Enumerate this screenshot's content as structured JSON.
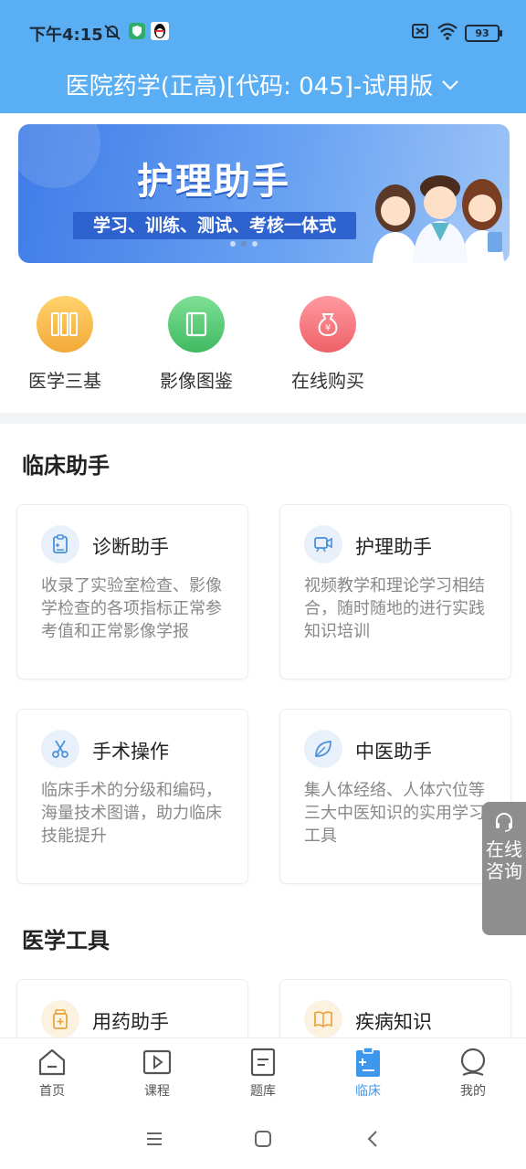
{
  "status": {
    "time": "下午4:15",
    "battery": "93"
  },
  "header": {
    "title": "医院药学(正高)[代码: 045]-试用版"
  },
  "banner": {
    "title": "护理助手",
    "slogan": "学习、训练、测试、考核一体式"
  },
  "quick": [
    {
      "label": "医学三基",
      "color": "#f7b84a",
      "icon": "books-icon"
    },
    {
      "label": "影像图鉴",
      "color": "#5fce7a",
      "icon": "album-icon"
    },
    {
      "label": "在线购买",
      "color": "#f37c82",
      "icon": "money-bag-icon"
    }
  ],
  "clinical": {
    "title": "临床助手",
    "cards": [
      {
        "title": "诊断助手",
        "desc": "收录了实验室检查、影像学检查的各项指标正常参考值和正常影像学报",
        "icon": "clipboard-icon"
      },
      {
        "title": "护理助手",
        "desc": "视频教学和理论学习相结合，随时随地的进行实践知识培训",
        "icon": "video-icon"
      },
      {
        "title": "手术操作",
        "desc": "临床手术的分级和编码，海量技术图谱，助力临床技能提升",
        "icon": "scissors-icon"
      },
      {
        "title": "中医助手",
        "desc": "集人体经络、人体穴位等三大中医知识的实用学习工具",
        "icon": "leaf-icon"
      }
    ]
  },
  "tools": {
    "title": "医学工具",
    "cards": [
      {
        "title": "用药助手",
        "icon": "medicine-bottle-icon"
      },
      {
        "title": "疾病知识",
        "icon": "book-icon"
      }
    ]
  },
  "consult": {
    "label": "在线咨询"
  },
  "tabs": [
    {
      "label": "首页",
      "icon": "home-icon"
    },
    {
      "label": "课程",
      "icon": "play-icon"
    },
    {
      "label": "题库",
      "icon": "document-icon"
    },
    {
      "label": "临床",
      "icon": "clinical-clipboard-icon",
      "active": true
    },
    {
      "label": "我的",
      "icon": "profile-icon"
    }
  ],
  "colors": {
    "accent": "#3d97ec",
    "header": "#5aaef4"
  }
}
